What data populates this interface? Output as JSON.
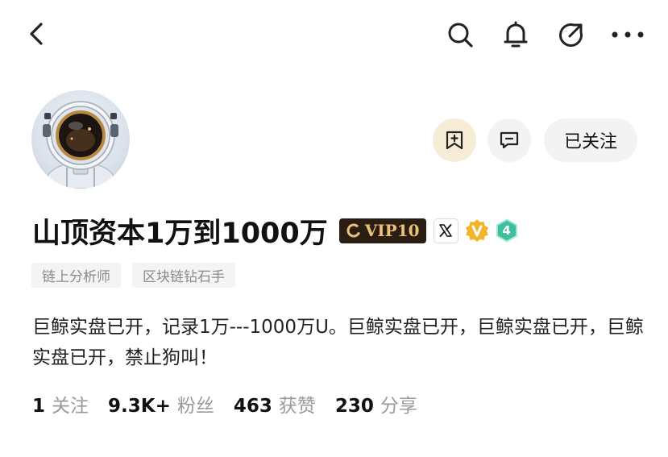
{
  "topbar": {
    "back_icon": "chevron-left-icon",
    "search_icon": "search-icon",
    "bell_icon": "bell-icon",
    "share_icon": "share-icon",
    "more_icon": "more-horizontal-icon"
  },
  "profile": {
    "avatar_alt": "astronaut-helmet",
    "name": "山顶资本1万到1000万",
    "vip_label": "VIP10",
    "level": "4",
    "tags": [
      "链上分析师",
      "区块链钻石手"
    ],
    "bio": "巨鲸实盘已开，记录1万---1000万U。巨鲸实盘已开，巨鲸实盘已开，巨鲸实盘已开，禁止狗叫！"
  },
  "actions": {
    "follow_label": "已关注"
  },
  "stats": [
    {
      "num": "1",
      "label": "关注"
    },
    {
      "num": "9.3K+",
      "label": "粉丝"
    },
    {
      "num": "463",
      "label": "获赞"
    },
    {
      "num": "230",
      "label": "分享"
    }
  ],
  "colors": {
    "vip_bg": "#2b1d12",
    "vip_text": "#e9c27a",
    "bookmark_bg": "#f7ecd6",
    "v_badge": "#f2b42a",
    "level_badge": "#3fbf9f"
  }
}
